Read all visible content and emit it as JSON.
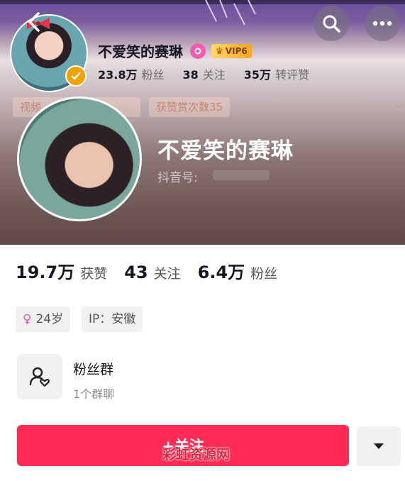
{
  "header": {
    "name": "不爱笑的赛琳",
    "vip_label": "VIP6",
    "stats": [
      {
        "value": "23.8万",
        "label": "粉丝"
      },
      {
        "value": "38",
        "label": "关注"
      },
      {
        "value": "35万",
        "label": "转评赞"
      }
    ],
    "chip_left": "视频 · · · 7名",
    "chip_right": "获赞赏次数35"
  },
  "profile": {
    "name": "不爱笑的赛琳",
    "douyin_id_label": "抖音号:"
  },
  "stats": [
    {
      "value": "19.7万",
      "label": "获赞"
    },
    {
      "value": "43",
      "label": "关注"
    },
    {
      "value": "6.4万",
      "label": "粉丝"
    }
  ],
  "tags": {
    "age": "24岁",
    "ip": "IP：安徽"
  },
  "fan_group": {
    "title": "粉丝群",
    "subtitle": "1个群聊"
  },
  "actions": {
    "follow_label": "+关注"
  },
  "watermark": "彩虹资源网",
  "colors": {
    "accent": "#fe2c55",
    "gold": "#f2a100",
    "pink": "#f15cae"
  },
  "icons": [
    "back-arrow-icon",
    "search-icon",
    "more-icon",
    "verified-icon",
    "pink-badge-icon",
    "crown-icon",
    "chevron-down-icon",
    "female-icon",
    "fan-group-icon",
    "dropdown-triangle-icon"
  ]
}
